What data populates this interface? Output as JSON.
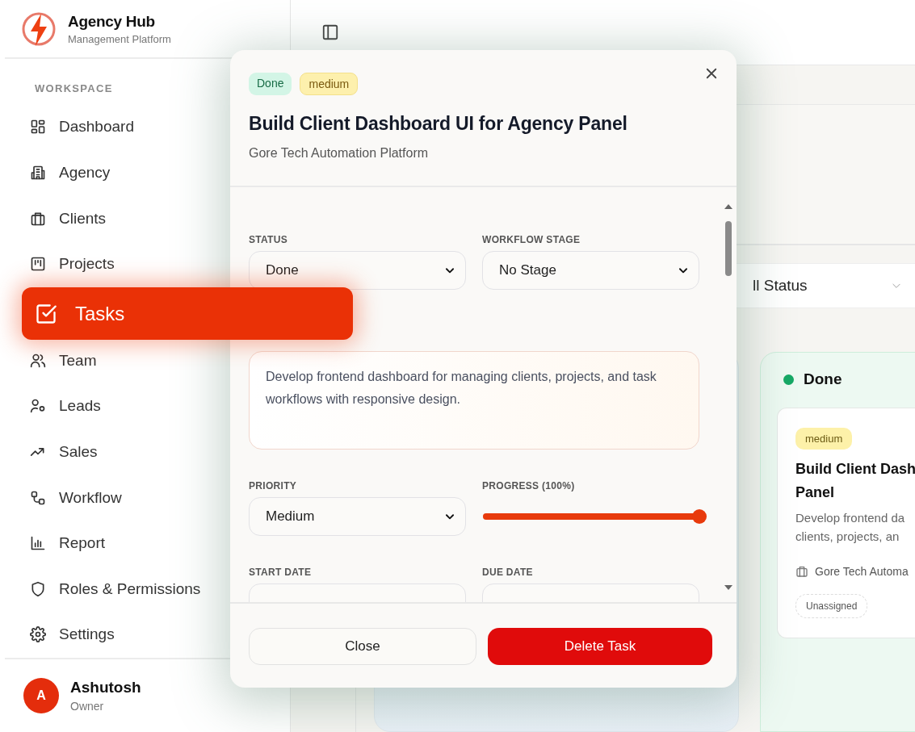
{
  "brand": {
    "name": "Agency Hub",
    "tagline": "Management Platform"
  },
  "sidebar": {
    "section": "WORKSPACE",
    "items": [
      {
        "label": "Dashboard",
        "selected": false
      },
      {
        "label": "Agency",
        "selected": false
      },
      {
        "label": "Clients",
        "selected": false
      },
      {
        "label": "Projects",
        "selected": false
      },
      {
        "label": "Tasks",
        "selected": true
      },
      {
        "label": "Team",
        "selected": false
      },
      {
        "label": "Leads",
        "selected": false
      },
      {
        "label": "Sales",
        "selected": false
      },
      {
        "label": "Workflow",
        "selected": false
      },
      {
        "label": "Report",
        "selected": false
      },
      {
        "label": "Roles & Permissions",
        "selected": false
      },
      {
        "label": "Settings",
        "selected": false
      }
    ]
  },
  "user": {
    "initial": "A",
    "name": "Ashutosh",
    "role": "Owner"
  },
  "filter": {
    "status": "ll Status"
  },
  "board": {
    "columns": [
      {
        "title": "Done",
        "color": "#16a865",
        "cards": [
          {
            "priority": "medium",
            "title_lines": [
              "Build Client Dash",
              "Panel"
            ],
            "description_lines": [
              "Develop frontend da",
              "clients, projects, an"
            ],
            "client": "Gore Tech Automa",
            "assignee": "Unassigned"
          }
        ]
      }
    ]
  },
  "modal": {
    "badges": [
      {
        "text": "Done",
        "kind": "status"
      },
      {
        "text": "medium",
        "kind": "priority"
      }
    ],
    "title": "Build Client Dashboard UI for Agency Panel",
    "subtitle": "Gore Tech Automation Platform",
    "status": {
      "label": "STATUS",
      "value": "Done"
    },
    "workflow_stage": {
      "label": "WORKFLOW STAGE",
      "value": "No Stage"
    },
    "description": "Develop frontend dashboard for managing clients, projects, and task workflows with responsive design.",
    "priority": {
      "label": "PRIORITY",
      "value": "Medium"
    },
    "progress": {
      "label": "PROGRESS (100%)",
      "level": 1
    },
    "start_date": {
      "label": "START DATE"
    },
    "due_date": {
      "label": "DUE DATE"
    },
    "buttons": [
      {
        "text": "Close",
        "kind": "secondary"
      },
      {
        "text": "Delete Task",
        "kind": "danger"
      }
    ]
  }
}
